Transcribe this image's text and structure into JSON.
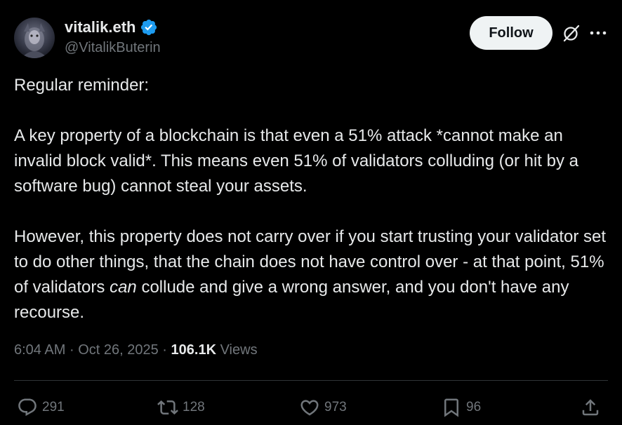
{
  "author": {
    "display_name": "vitalik.eth",
    "handle": "@VitalikButerin",
    "verified": true
  },
  "follow_label": "Follow",
  "icons": {
    "grok": "grok-icon",
    "more": "more-options-icon",
    "reply": "reply-icon",
    "repost": "repost-icon",
    "like": "like-icon",
    "bookmark": "bookmark-icon",
    "share": "share-icon"
  },
  "tweet": {
    "line1": "Regular reminder:",
    "p2": "A key property of a blockchain is that even a 51% attack *cannot make an invalid block valid*. This means even 51% of validators colluding (or hit by a software bug) cannot steal your assets.",
    "p3_before": "However, this property does not carry over if you start trusting your validator set to do other things, that the chain does not have control over - at that point, 51% of validators ",
    "p3_emph": "can",
    "p3_after": " collude and give a wrong answer, and you don't have any recourse."
  },
  "meta": {
    "time": "6:04 AM",
    "sep1": "·",
    "date": "Oct 26, 2025",
    "sep2": "·",
    "views_count": "106.1K",
    "views_label": "Views"
  },
  "actions": {
    "replies": "291",
    "reposts": "128",
    "likes": "973",
    "bookmarks": "96"
  },
  "colors": {
    "background": "#000000",
    "text": "#e7e9ea",
    "secondary": "#71767b",
    "verified": "#1d9bf0",
    "follow_bg": "#eff3f4"
  }
}
